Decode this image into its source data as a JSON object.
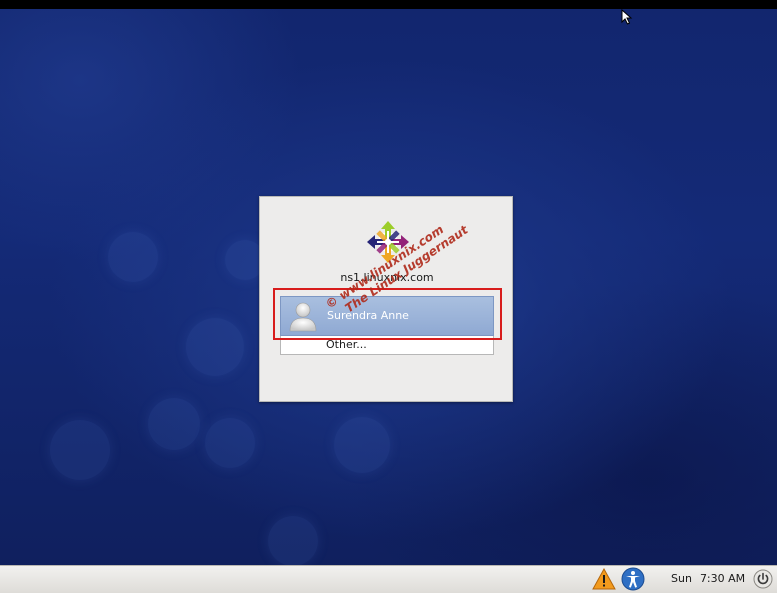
{
  "login": {
    "hostname": "ns1.linuxnix.com",
    "users": [
      {
        "name": "Surendra Anne",
        "selected": true
      }
    ],
    "other_label": "Other..."
  },
  "watermark": {
    "line1": "© www.linuxnix.com",
    "line2": "The Linux Juggernaut"
  },
  "panel": {
    "day": "Sun",
    "time": "7:30 AM",
    "icons": [
      "warning-icon",
      "accessibility-icon",
      "power-icon"
    ]
  },
  "colors": {
    "desktop_bg": "#142a77",
    "selected_user_bg": "#9bb3da",
    "highlight_border": "#d81c1c"
  }
}
